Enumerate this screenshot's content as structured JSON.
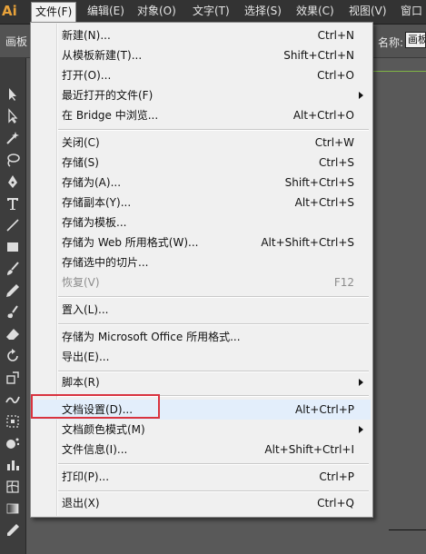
{
  "app": {
    "logo": "Ai"
  },
  "menubar": {
    "items": [
      "文件(F)",
      "编辑(E)",
      "对象(O)",
      "文字(T)",
      "选择(S)",
      "效果(C)",
      "视图(V)",
      "窗口"
    ]
  },
  "controlbar": {
    "left_label": "画板",
    "name_label": "名称:",
    "name_value": "画板"
  },
  "file_menu": {
    "items": [
      {
        "label": "新建(N)...",
        "shortcut": "Ctrl+N"
      },
      {
        "label": "从模板新建(T)...",
        "shortcut": "Shift+Ctrl+N"
      },
      {
        "label": "打开(O)...",
        "shortcut": "Ctrl+O"
      },
      {
        "label": "最近打开的文件(F)",
        "shortcut": ""
      },
      {
        "label": "在 Bridge 中浏览...",
        "shortcut": "Alt+Ctrl+O"
      },
      {
        "label": "关闭(C)",
        "shortcut": "Ctrl+W"
      },
      {
        "label": "存储(S)",
        "shortcut": "Ctrl+S"
      },
      {
        "label": "存储为(A)...",
        "shortcut": "Shift+Ctrl+S"
      },
      {
        "label": "存储副本(Y)...",
        "shortcut": "Alt+Ctrl+S"
      },
      {
        "label": "存储为模板...",
        "shortcut": ""
      },
      {
        "label": "存储为 Web 所用格式(W)...",
        "shortcut": "Alt+Shift+Ctrl+S"
      },
      {
        "label": "存储选中的切片...",
        "shortcut": ""
      },
      {
        "label": "恢复(V)",
        "shortcut": "F12"
      },
      {
        "label": "置入(L)...",
        "shortcut": ""
      },
      {
        "label": "存储为 Microsoft Office 所用格式...",
        "shortcut": ""
      },
      {
        "label": "导出(E)...",
        "shortcut": ""
      },
      {
        "label": "脚本(R)",
        "shortcut": ""
      },
      {
        "label": "文档设置(D)...",
        "shortcut": "Alt+Ctrl+P"
      },
      {
        "label": "文档颜色模式(M)",
        "shortcut": ""
      },
      {
        "label": "文件信息(I)...",
        "shortcut": "Alt+Shift+Ctrl+I"
      },
      {
        "label": "打印(P)...",
        "shortcut": "Ctrl+P"
      },
      {
        "label": "退出(X)",
        "shortcut": "Ctrl+Q"
      }
    ]
  },
  "tools": [
    "selection-tool",
    "direct-selection-tool",
    "magic-wand-tool",
    "lasso-tool",
    "pen-tool",
    "type-tool",
    "line-tool",
    "rectangle-tool",
    "paintbrush-tool",
    "pencil-tool",
    "blob-brush-tool",
    "eraser-tool",
    "rotate-tool",
    "scale-tool",
    "warp-tool",
    "free-transform-tool",
    "symbol-sprayer-tool",
    "column-graph-tool",
    "mesh-tool",
    "gradient-tool",
    "eyedropper-tool",
    "blend-tool"
  ],
  "colors": {
    "highlight_box": "#d9333f",
    "logo": "#e8a23a"
  }
}
